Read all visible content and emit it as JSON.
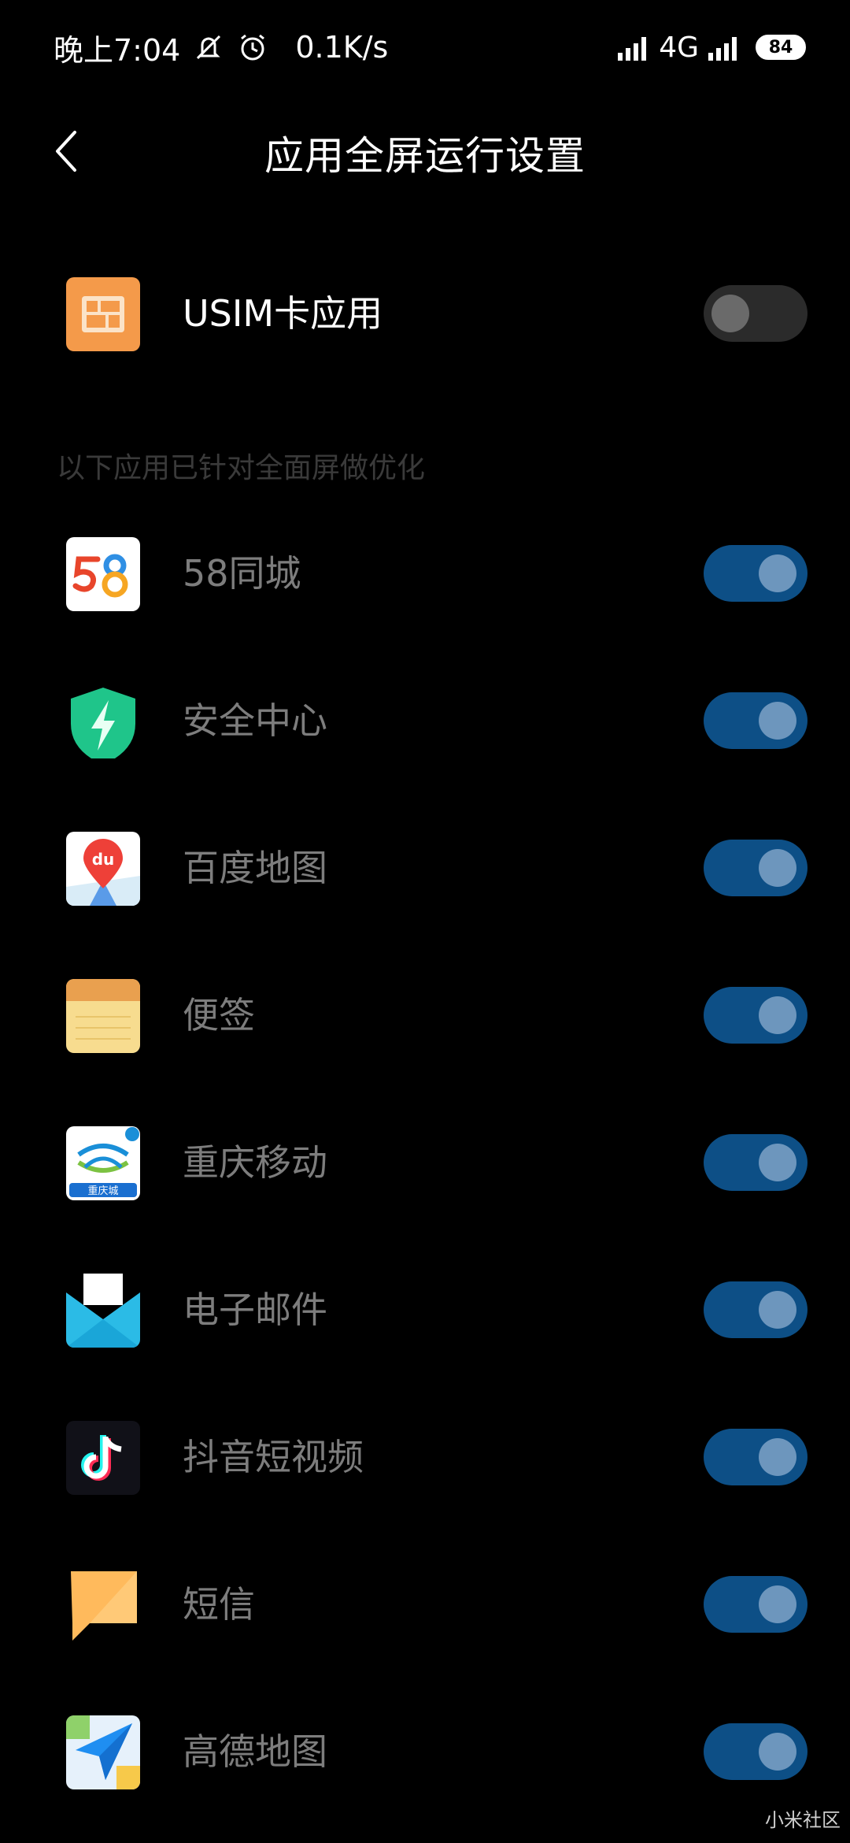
{
  "status_bar": {
    "time": "晚上7:04",
    "net_speed": "0.1K/s",
    "network": "4G",
    "battery": "84"
  },
  "header": {
    "title": "应用全屏运行设置"
  },
  "top_item": {
    "label": "USIM卡应用",
    "toggle_on": false,
    "icon": "sim-card-icon"
  },
  "section_header": "以下应用已针对全面屏做优化",
  "apps": [
    {
      "label": "58同城",
      "icon": "58-tongcheng-icon",
      "toggle_on": true
    },
    {
      "label": "安全中心",
      "icon": "security-center-icon",
      "toggle_on": true
    },
    {
      "label": "百度地图",
      "icon": "baidu-map-icon",
      "toggle_on": true
    },
    {
      "label": "便签",
      "icon": "notes-icon",
      "toggle_on": true
    },
    {
      "label": "重庆移动",
      "icon": "china-mobile-icon",
      "toggle_on": true
    },
    {
      "label": "电子邮件",
      "icon": "email-icon",
      "toggle_on": true
    },
    {
      "label": "抖音短视频",
      "icon": "douyin-icon",
      "toggle_on": true
    },
    {
      "label": "短信",
      "icon": "messages-icon",
      "toggle_on": true
    },
    {
      "label": "高德地图",
      "icon": "amap-icon",
      "toggle_on": true
    }
  ],
  "watermark": "小米社区",
  "cmcc_badge": "重庆城",
  "colors": {
    "background": "#000000",
    "toggle_on_track": "#0d4f86",
    "toggle_on_knob": "#6d96bd",
    "toggle_off_track": "#2b2b2b",
    "toggle_off_knob": "#6a6a6a"
  }
}
